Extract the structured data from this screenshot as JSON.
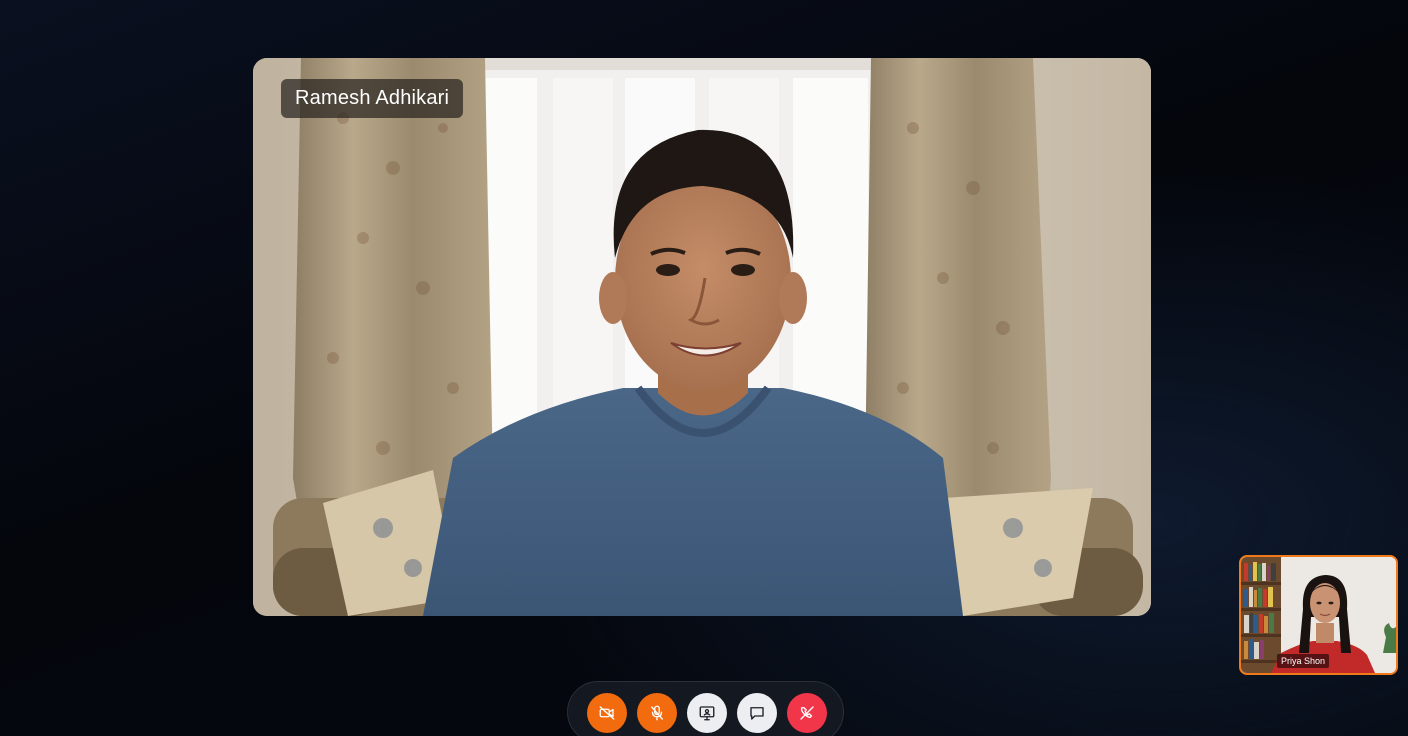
{
  "main_participant": {
    "name": "Ramesh Adhikari"
  },
  "self_view": {
    "name": "Priya Shon",
    "border_color": "#f07a1a"
  },
  "controls": [
    {
      "id": "camera",
      "icon": "video-off-icon",
      "state": "off",
      "color": "#f26b0f"
    },
    {
      "id": "microphone",
      "icon": "mic-off-icon",
      "state": "muted",
      "color": "#f26b0f"
    },
    {
      "id": "share-screen",
      "icon": "screen-share-icon",
      "color": "#eceef1"
    },
    {
      "id": "chat",
      "icon": "chat-icon",
      "color": "#eceef1"
    },
    {
      "id": "end-call",
      "icon": "phone-hangup-icon",
      "color": "#f2364a"
    }
  ]
}
